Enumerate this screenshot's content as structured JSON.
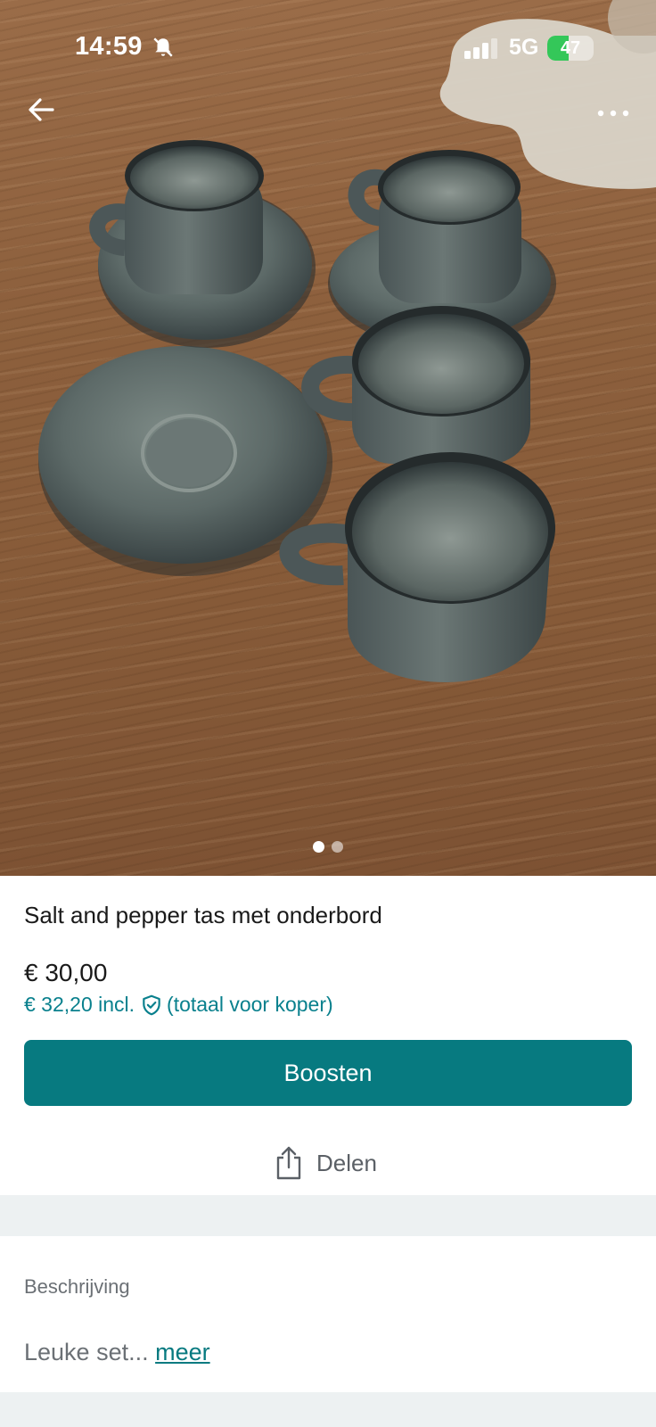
{
  "status_bar": {
    "time": "14:59",
    "network": "5G",
    "battery": "47",
    "battery_level": 0.47,
    "bell_icon": "bell-slash-icon",
    "signal_icon": "signal-bars-icon"
  },
  "nav": {
    "back_icon": "arrow-left-icon",
    "more_icon": "ellipsis-icon"
  },
  "gallery": {
    "image_count": 2,
    "active_index": 0
  },
  "listing": {
    "title": "Salt and pepper tas met onderbord",
    "price": "€ 30,00",
    "price_incl": "€ 32,20 incl.",
    "price_incl_suffix": "(totaal voor koper)",
    "shield_icon": "shield-check-icon"
  },
  "actions": {
    "boost_label": "Boosten",
    "share_label": "Delen",
    "share_icon": "share-icon"
  },
  "description": {
    "label": "Beschrijving",
    "text": "Leuke set...",
    "more_label": "meer"
  },
  "colors": {
    "accent": "#077a80",
    "link": "#09808d",
    "band": "#edf1f2"
  }
}
